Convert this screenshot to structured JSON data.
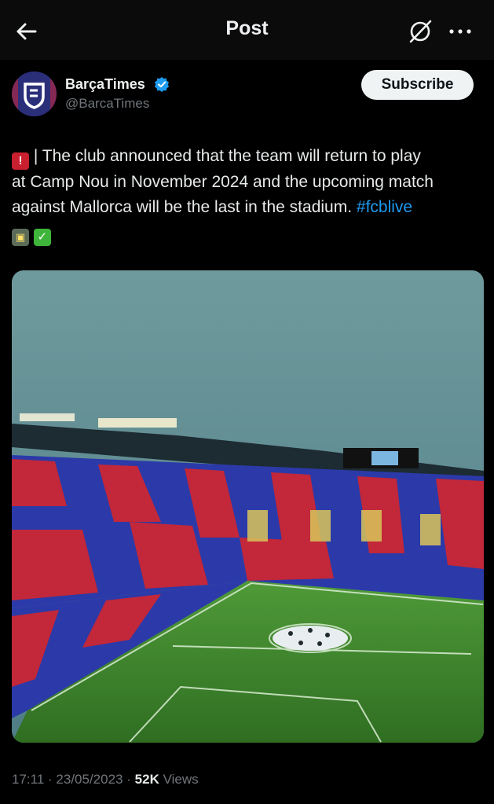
{
  "header": {
    "title": "Post",
    "back_icon": "arrow-left-icon",
    "grok_icon": "grok-icon",
    "more_icon": "more-horizontal-icon"
  },
  "author": {
    "name": "BarçaTimes",
    "handle": "@BarcaTimes",
    "verified_icon": "verified-badge-icon",
    "verified_color": "#1d9bf0",
    "avatar_color": "#2b2f7a"
  },
  "subscribe_label": "Subscribe",
  "tweet": {
    "line1_emoji": "siren-emoji",
    "line1": "| The club announced that the team will return to play",
    "line2": "at Camp Nou in November 2024 and the upcoming match",
    "line3": "against Mallorca will be the last in the stadium.",
    "hashtag": "#fcblive",
    "trailing_emojis": [
      "stadium-emoji",
      "check-mark-emoji"
    ]
  },
  "media": {
    "description_icon": "stadium-photo",
    "colors": {
      "blaugrana_red": "#c2273a",
      "blaugrana_blue": "#2b3aa8",
      "pitch": "#3f8a2e"
    }
  },
  "meta": {
    "time": "17:11",
    "separator": "·",
    "date": "23/05/2023",
    "views_count": "52K",
    "views_label": "Views"
  }
}
